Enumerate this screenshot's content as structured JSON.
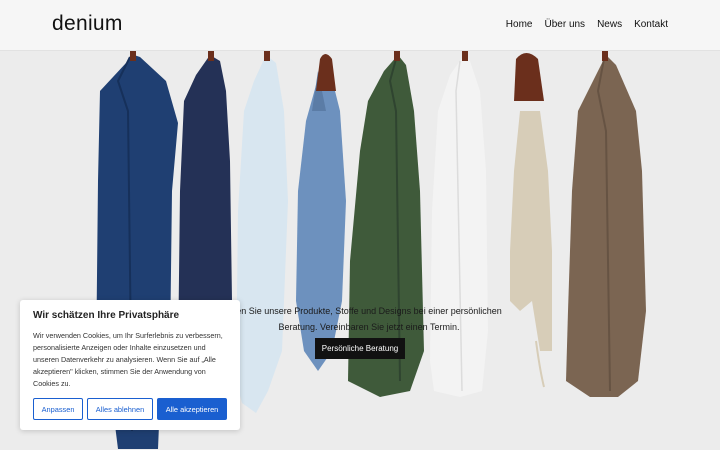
{
  "header": {
    "logo": "denium",
    "nav": [
      "Home",
      "Über uns",
      "News",
      "Kontakt"
    ]
  },
  "hero": {
    "text": "en Sie unsere Produkte, Stoffe und Designs bei einer persönlichen Beratung. Vereinbaren Sie jetzt einen Termin.",
    "cta_label": "Persönliche Beratung",
    "garments": [
      {
        "name": "navy-jacket",
        "color": "#1f3f72"
      },
      {
        "name": "dark-navy-shirt",
        "color": "#243156"
      },
      {
        "name": "light-blue-shirt",
        "color": "#d8e6f0"
      },
      {
        "name": "jeans",
        "color": "#6d91be"
      },
      {
        "name": "green-jacket",
        "color": "#3f5a3a"
      },
      {
        "name": "white-shirt",
        "color": "#f3f3f3"
      },
      {
        "name": "beige-trousers",
        "color": "#d7cdb8"
      },
      {
        "name": "brown-jacket",
        "color": "#7b6552"
      }
    ]
  },
  "cookie": {
    "title": "Wir schätzen Ihre Privatsphäre",
    "text": "Wir verwenden Cookies, um Ihr Surferlebnis zu verbessern, personalisierte Anzeigen oder Inhalte einzusetzen und unseren Datenverkehr zu analysieren. Wenn Sie auf „Alle akzeptieren\" klicken, stimmen Sie der Anwendung von Cookies zu.",
    "btn_customize": "Anpassen",
    "btn_reject": "Alles ablehnen",
    "btn_accept": "Alle akzeptieren",
    "accent": "#1a5fd0"
  }
}
